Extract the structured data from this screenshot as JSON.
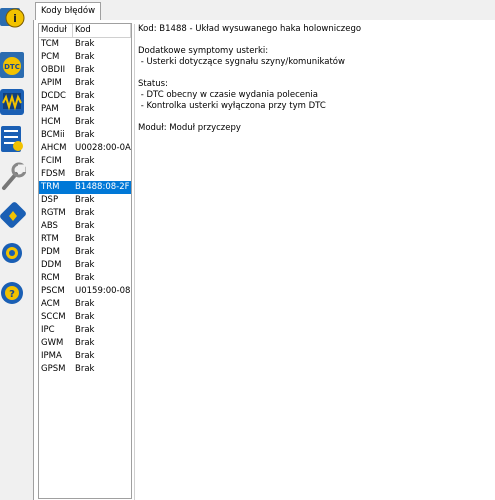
{
  "tab": {
    "label": "Kody błędów"
  },
  "table": {
    "headers": [
      "Moduł",
      "Kod"
    ],
    "rows": [
      {
        "module": "TCM",
        "code": "Brak"
      },
      {
        "module": "PCM",
        "code": "Brak"
      },
      {
        "module": "OBDII",
        "code": "Brak"
      },
      {
        "module": "APIM",
        "code": "Brak"
      },
      {
        "module": "DCDC",
        "code": "Brak"
      },
      {
        "module": "PAM",
        "code": "Brak"
      },
      {
        "module": "HCM",
        "code": "Brak"
      },
      {
        "module": "BCMii",
        "code": "Brak"
      },
      {
        "module": "AHCM",
        "code": "U0028:00-0A"
      },
      {
        "module": "FCIM",
        "code": "Brak"
      },
      {
        "module": "FDSM",
        "code": "Brak"
      },
      {
        "module": "TRM",
        "code": "B1488:08-2F"
      },
      {
        "module": "DSP",
        "code": "Brak"
      },
      {
        "module": "RGTM",
        "code": "Brak"
      },
      {
        "module": "ABS",
        "code": "Brak"
      },
      {
        "module": "RTM",
        "code": "Brak"
      },
      {
        "module": "PDM",
        "code": "Brak"
      },
      {
        "module": "DDM",
        "code": "Brak"
      },
      {
        "module": "RCM",
        "code": "Brak"
      },
      {
        "module": "PSCM",
        "code": "U0159:00-08"
      },
      {
        "module": "ACM",
        "code": "Brak"
      },
      {
        "module": "SCCM",
        "code": "Brak"
      },
      {
        "module": "IPC",
        "code": "Brak"
      },
      {
        "module": "GWM",
        "code": "Brak"
      },
      {
        "module": "IPMA",
        "code": "Brak"
      },
      {
        "module": "GPSM",
        "code": "Brak"
      }
    ],
    "selected_index": 11
  },
  "detail": {
    "lines": [
      "Kod: B1488 - Układ wysuwanego haka holowniczego",
      "",
      "Dodatkowe symptomy usterki:",
      " - Usterki dotyczące sygnału szyny/komunikatów",
      "",
      "Status:",
      " - DTC obecny w czasie wydania polecenia",
      " - Kontrolka usterki wyłączona przy tym DTC",
      "",
      "Moduł: Moduł przyczepy"
    ]
  },
  "sidebar": {
    "icons": [
      "info-icon",
      "dtc-icon",
      "oscilloscope-icon",
      "checklist-icon",
      "wrench-icon",
      "chip-icon",
      "gear-icon",
      "help-icon"
    ]
  },
  "colors": {
    "selection": "#0078d7",
    "accent": "#1a6fc4",
    "yellow": "#f2c200"
  }
}
